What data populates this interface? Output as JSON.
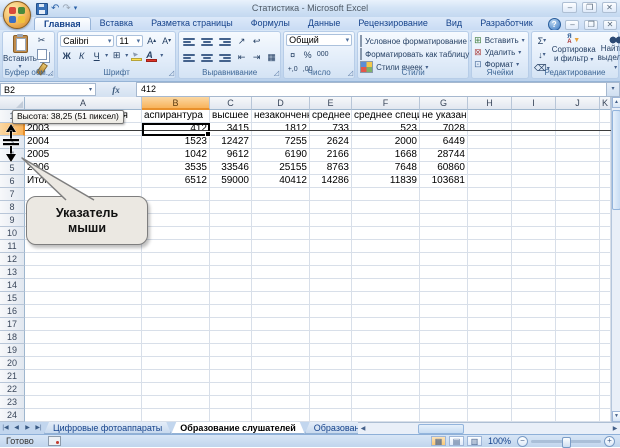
{
  "window": {
    "title": "Статистика - Microsoft Excel"
  },
  "icons": {
    "dropdown": "▾",
    "cut": "✂",
    "borders": "⊞",
    "sum": "Σ",
    "wrap": "↩",
    "indent_inc": "⇥",
    "indent_dec": "⇤",
    "orientation": "↗",
    "currency": "¤",
    "percent_note": "",
    "insert_cells": "⊞",
    "delete_cells": "⊠",
    "format_cells": "⊡",
    "fill_down": "↓",
    "clear": "⌫",
    "up": "▲",
    "down": "▼",
    "left": "◀",
    "right": "▶",
    "undo": "↶",
    "redo": "↷",
    "help": "?",
    "minimize": "–",
    "restore": "❐",
    "close": "✕",
    "grow_font": "А",
    "shrink_font": "А",
    "view_normal": "▦",
    "view_layout": "▤",
    "view_break": "▥"
  },
  "ribbon_tabs": [
    {
      "label": "Главная",
      "active": true
    },
    {
      "label": "Вставка",
      "active": false
    },
    {
      "label": "Разметка страницы",
      "active": false
    },
    {
      "label": "Формулы",
      "active": false
    },
    {
      "label": "Данные",
      "active": false
    },
    {
      "label": "Рецензирование",
      "active": false
    },
    {
      "label": "Вид",
      "active": false
    },
    {
      "label": "Разработчик",
      "active": false
    }
  ],
  "ribbon": {
    "clipboard": {
      "label": "Буфер обм...",
      "paste": "Вставить"
    },
    "font": {
      "label": "Шрифт",
      "name": "Calibri",
      "size": "11",
      "bold": "Ж",
      "italic": "К",
      "underline": "Ч"
    },
    "alignment": {
      "label": "Выравнивание"
    },
    "number": {
      "label": "Число",
      "format": "Общий",
      "percent": "%",
      "thousands": "000",
      "inc_decimal": "+,0",
      "dec_decimal": ",00"
    },
    "styles": {
      "label": "Стили",
      "conditional": "Условное форматирование",
      "as_table": "Форматировать как таблицу",
      "cell_styles": "Стили ячеек"
    },
    "cells": {
      "label": "Ячейки",
      "insert": "Вставить",
      "delete": "Удалить",
      "format": "Формат"
    },
    "editing": {
      "label": "Редактирование",
      "sort_line1": "Сортировка",
      "sort_line2": "и фильтр",
      "find_line1": "Найти и",
      "find_line2": "выделить"
    }
  },
  "formula_bar": {
    "name_box": "B2",
    "fx": "fx",
    "value": "412"
  },
  "grid": {
    "columns": [
      "A",
      "B",
      "C",
      "D",
      "E",
      "F",
      "G",
      "H",
      "I",
      "J",
      "K"
    ],
    "selected_column": "B",
    "selected_row": 2,
    "row_count": 24,
    "rows": [
      {
        "n": 1,
        "cells": {
          "A": "Уровень образования",
          "B": "аспирантура",
          "C": "высшее",
          "D": "незаконченное высшее",
          "E": "среднее",
          "F": "среднее специальное",
          "G": "не указано"
        }
      },
      {
        "n": 2,
        "cells": {
          "A": "2003",
          "B": "412",
          "C": "3415",
          "D": "1812",
          "E": "733",
          "F": "523",
          "G": "7028"
        }
      },
      {
        "n": 3,
        "cells": {
          "A": "2004",
          "B": "1523",
          "C": "12427",
          "D": "7255",
          "E": "2624",
          "F": "2000",
          "G": "6449"
        }
      },
      {
        "n": 4,
        "cells": {
          "A": "2005",
          "B": "1042",
          "C": "9612",
          "D": "6190",
          "E": "2166",
          "F": "1668",
          "G": "28744"
        }
      },
      {
        "n": 5,
        "cells": {
          "A": "2006",
          "B": "3535",
          "C": "33546",
          "D": "25155",
          "E": "8763",
          "F": "7648",
          "G": "60860"
        }
      },
      {
        "n": 6,
        "cells": {
          "A": "Итого",
          "B": "6512",
          "C": "59000",
          "D": "40412",
          "E": "14286",
          "F": "11839",
          "G": "103681"
        }
      }
    ]
  },
  "height_tooltip": "Высота: 38,25 (51 пиксел)",
  "callout": {
    "line1": "Указатель",
    "line2": "мыши"
  },
  "sheet_tabs": [
    {
      "label": "Цифровые фотоаппараты",
      "active": false
    },
    {
      "label": "Образование слушателей",
      "active": true
    },
    {
      "label": "Образование слушателей",
      "active": false
    }
  ],
  "status_bar": {
    "ready": "Готово",
    "zoom": "100%"
  }
}
